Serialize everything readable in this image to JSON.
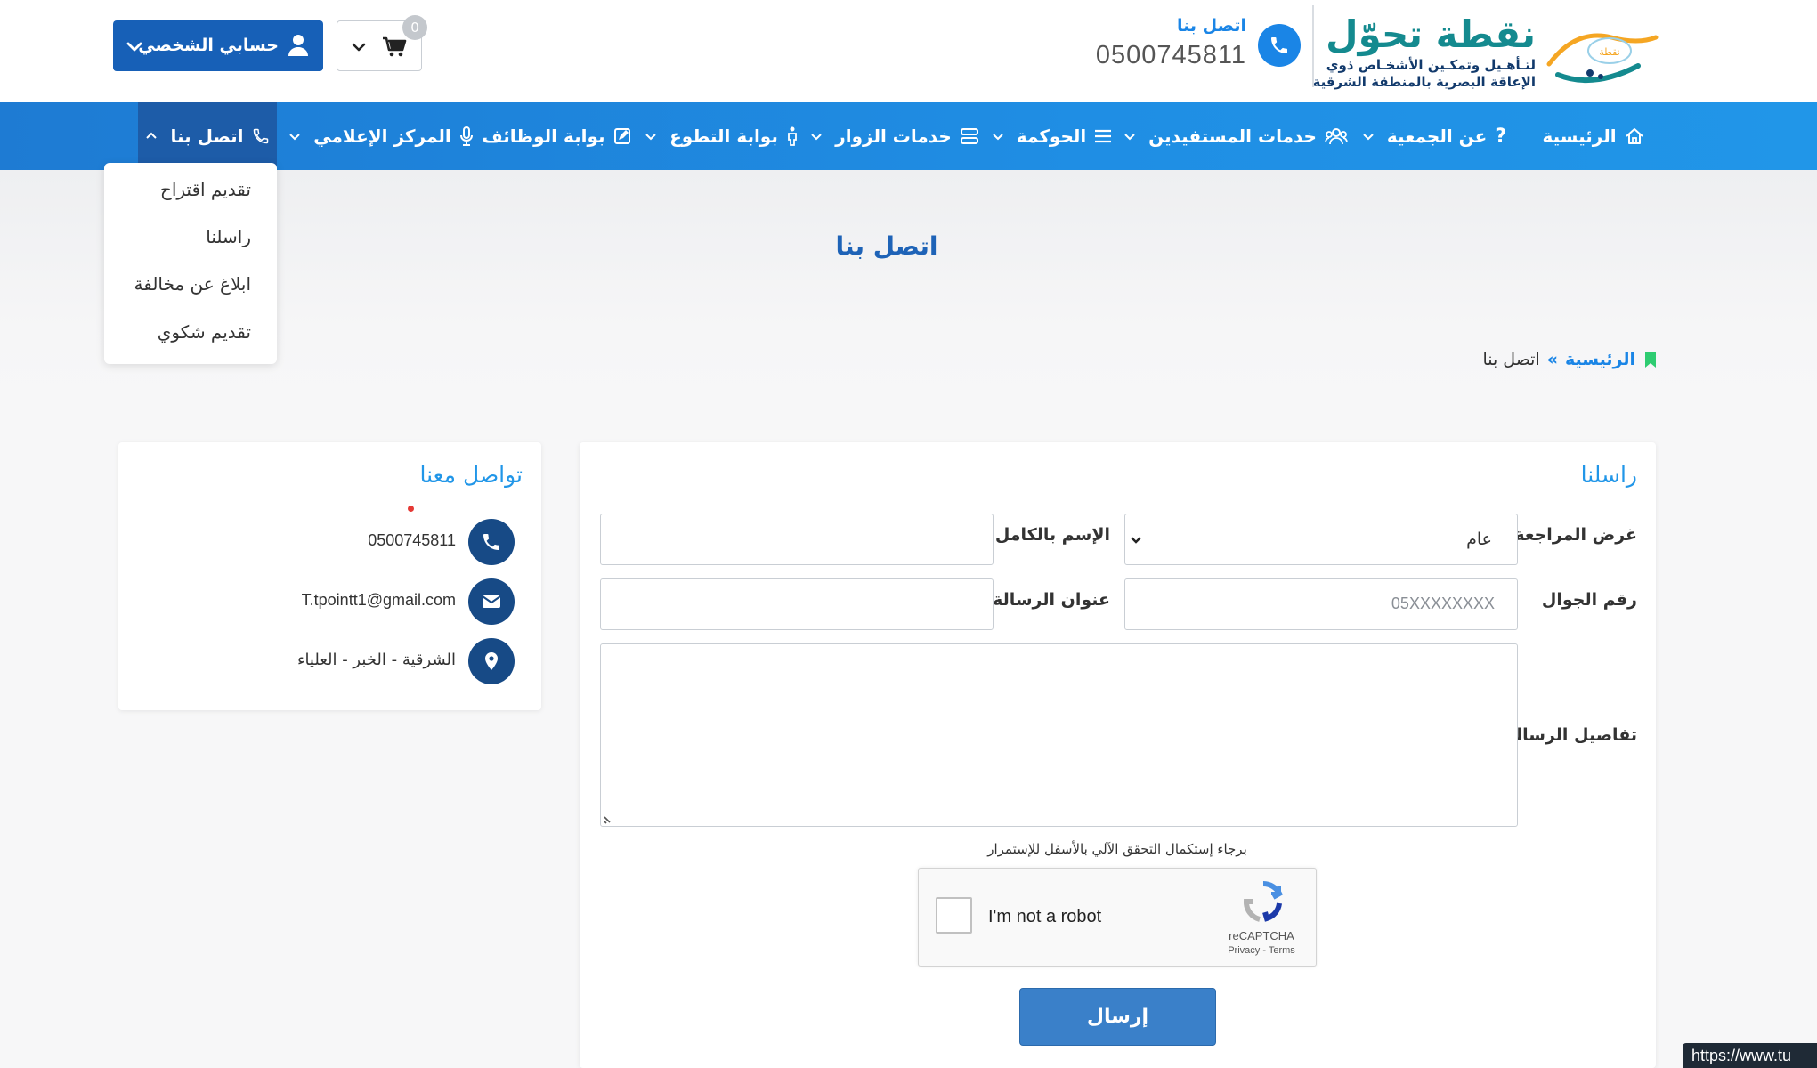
{
  "header": {
    "logo_title": "نقطة تحوّل",
    "logo_subtitle_line1": "لتـأهـيل وتمكـين الأشخـاص ذوي",
    "logo_subtitle_line2": "الإعاقة البصرية بالمنطقة الشرقية",
    "logo_mark_text": "نقطة",
    "call_label": "اتصل بنا",
    "phone": "0500745811",
    "cart_count": "0",
    "account_label": "حسابي الشخصي"
  },
  "nav": {
    "items": [
      {
        "label": "الرئيسية",
        "icon": "home-icon"
      },
      {
        "label": "عن الجمعية",
        "icon": "question-icon"
      },
      {
        "label": "خدمات المستفيدين",
        "icon": "users-icon"
      },
      {
        "label": "الحوكمة",
        "icon": "list-icon"
      },
      {
        "label": "خدمات الزوار",
        "icon": "server-icon"
      },
      {
        "label": "بوابة التطوع",
        "icon": "person-icon"
      },
      {
        "label": "بوابة الوظائف",
        "icon": "edit-icon"
      },
      {
        "label": "المركز الإعلامي",
        "icon": "microphone-icon"
      },
      {
        "label": "اتصل بنا",
        "icon": "phone-icon"
      }
    ],
    "dropdown": [
      "تقديم اقتراح",
      "راسلنا",
      "ابلاغ عن مخالفة",
      "تقديم شكوي"
    ]
  },
  "page": {
    "title": "اتصل بنا",
    "breadcrumb_home": "الرئيسية",
    "breadcrumb_sep": "»",
    "breadcrumb_current": "اتصل بنا"
  },
  "form": {
    "heading": "راسلنا",
    "purpose_label": "غرض المراجعة",
    "purpose_value": "عام",
    "name_label": "الإسم بالكامل",
    "name_value": "",
    "mobile_label": "رقم الجوال",
    "mobile_placeholder": "05XXXXXXXX",
    "subject_label": "عنوان الرسالة",
    "subject_value": "",
    "details_label": "تفاصيل الرسالة",
    "captcha_note": "برجاء إستكمال التحقق الآلي بالأسفل للإستمرار",
    "captcha_text": "I'm not a robot",
    "captcha_brand": "reCAPTCHA",
    "captcha_links": "Privacy - Terms",
    "submit_label": "إرسال"
  },
  "info": {
    "heading": "تواصل معنا",
    "phone": "0500745811",
    "email": "T.tpointt1@gmail.com",
    "address": "الشرقية - الخبر - العلياء"
  },
  "status_url": "https://www.tu",
  "colors": {
    "nav_blue": "#1f8ee4",
    "nav_active": "#1d5ca8",
    "account_btn": "#1760b7",
    "heading_blue": "#2196e8",
    "info_circle": "#174a86",
    "bookmark_green": "#2ecc71"
  }
}
